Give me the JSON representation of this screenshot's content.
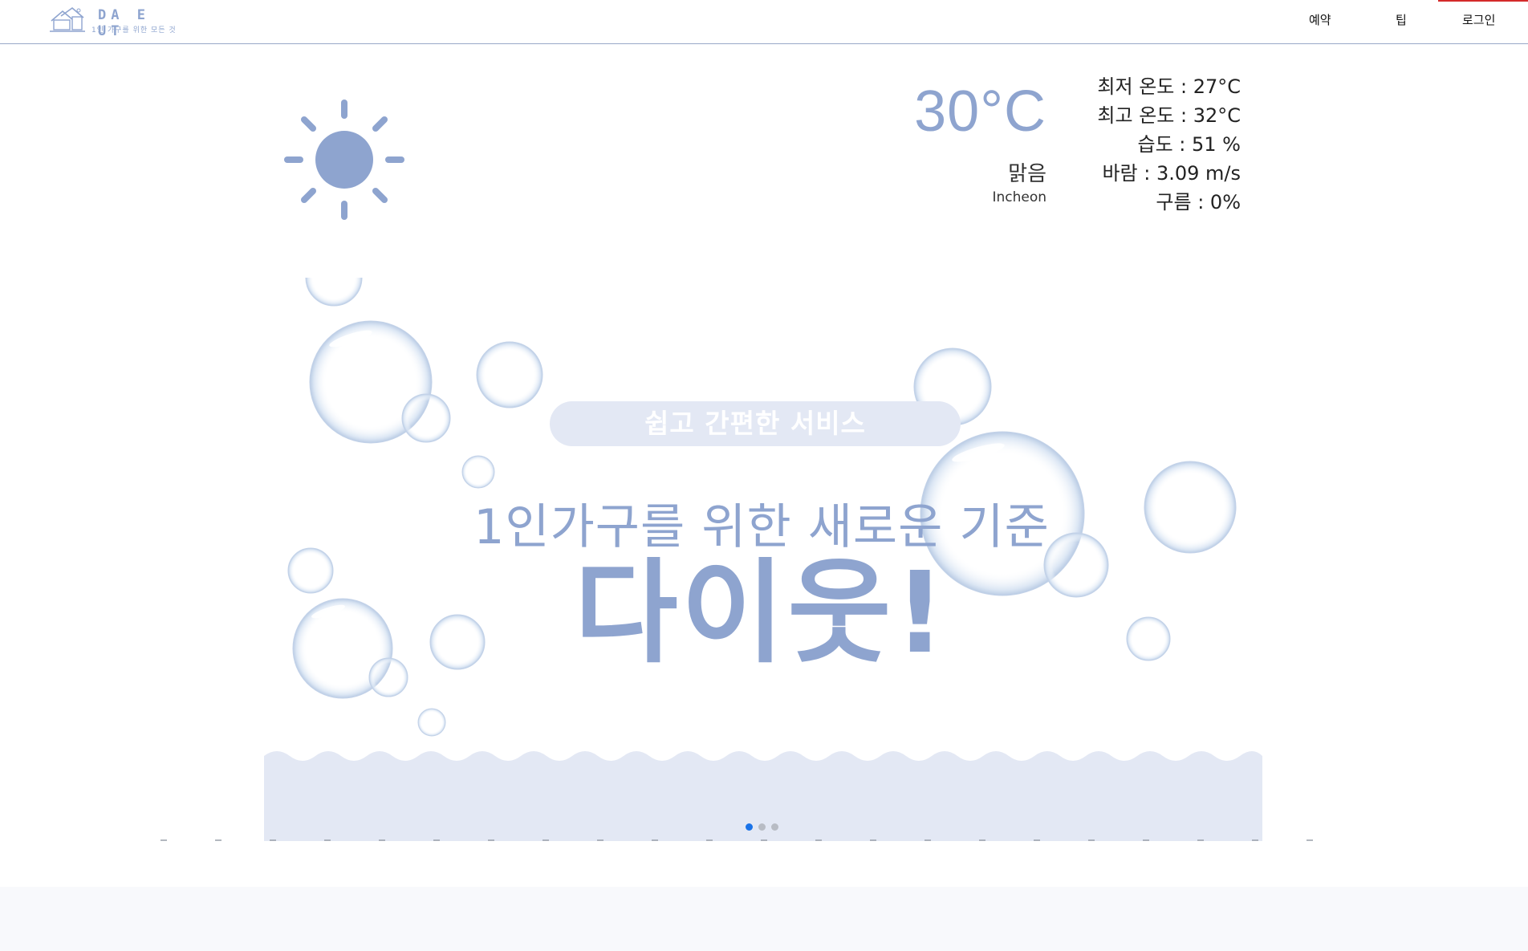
{
  "header": {
    "logo": {
      "name": "DA E UT",
      "tagline": "1인 가구를 위한 모든 것"
    },
    "nav": [
      {
        "label": "예약"
      },
      {
        "label": "팁"
      },
      {
        "label": "로그인"
      }
    ],
    "accent_line_color": "#d42a2a"
  },
  "weather": {
    "icon": "sun-icon",
    "temperature": "30°C",
    "condition": "맑음",
    "city": "Incheon",
    "stats": [
      "최저 온도 : 27°C",
      "최고 온도 : 32°C",
      "습도 : 51 %",
      "바람 : 3.09 m/s",
      "구름 : 0%"
    ]
  },
  "hero": {
    "pill": "쉽고 간편한 서비스",
    "subtitle": "1인가구를 위한 새로운 기준",
    "brand": "다이웃!",
    "slides": {
      "count": 3,
      "active": 0
    }
  },
  "colors": {
    "accent": "#8ea4cf",
    "band": "#e3e8f4",
    "dot_active": "#1a73e8",
    "dot_inactive": "#b8bcc4"
  }
}
